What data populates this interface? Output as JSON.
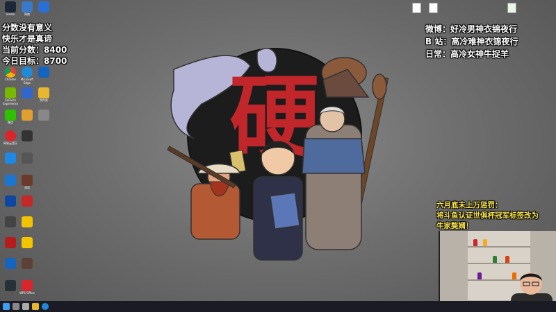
{
  "overlay_left": {
    "line1": "分数没有意义",
    "line2": "快乐才是真谛",
    "line3": "当前分数：8400",
    "line4": "今日目标：8700"
  },
  "overlay_right": {
    "weibo": "微博：好冷男神衣锦夜行",
    "bilibili": "B 站：高冷难神衣锦夜行",
    "daily": "日常：高冷女神牛捉羊"
  },
  "notice": {
    "line1": "六月底未上万惩罚：",
    "line2": "将斗鱼认证世俱杯冠军标签改为",
    "line3": "牛家獒婿！"
  },
  "wallpaper": {
    "emblem_char": "硬"
  },
  "colors": {
    "emblem_red": "#c0262a",
    "notice_yellow": "#f7e24a",
    "taskbar": "#1b1b26"
  },
  "desktop_icons": [
    {
      "icon": "steam-icon",
      "label": "Steam"
    },
    {
      "icon": "network-icon",
      "label": "网络"
    },
    {
      "icon": "chrome-icon",
      "label": "Chrome"
    },
    {
      "icon": "edge-icon",
      "label": "Microsoft Edge"
    },
    {
      "icon": "nvidia-icon",
      "label": "GeForce Experience"
    },
    {
      "icon": "folder-icon",
      "label": "文件夹"
    },
    {
      "icon": "wechat-icon",
      "label": "微信"
    },
    {
      "icon": "netease-music-icon",
      "label": "网易云音乐"
    },
    {
      "icon": "game-icon",
      "label": "游戏"
    },
    {
      "icon": "wps-icon",
      "label": "WPS Office"
    }
  ],
  "taskbar_icons": [
    "windows-icon",
    "search-icon",
    "task-view-icon",
    "file-explorer-icon",
    "edge-icon"
  ]
}
